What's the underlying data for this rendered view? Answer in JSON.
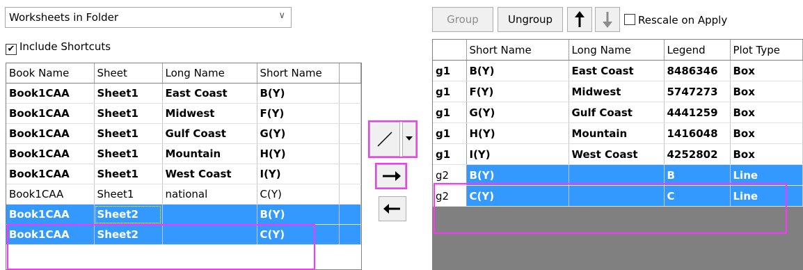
{
  "source_combo": {
    "value": "Worksheets in Folder"
  },
  "include_shortcuts": {
    "label": "Include Shortcuts",
    "checked": true
  },
  "left_table": {
    "headers": [
      "Book Name",
      "Sheet",
      "Long Name",
      "Short Name"
    ],
    "rows": [
      {
        "book": "Book1CAA",
        "sheet": "Sheet1",
        "long": "East Coast",
        "short": "B(Y)",
        "style": "bold"
      },
      {
        "book": "Book1CAA",
        "sheet": "Sheet1",
        "long": "Midwest",
        "short": "F(Y)",
        "style": "bold"
      },
      {
        "book": "Book1CAA",
        "sheet": "Sheet1",
        "long": "Gulf Coast",
        "short": "G(Y)",
        "style": "bold"
      },
      {
        "book": "Book1CAA",
        "sheet": "Sheet1",
        "long": "Mountain",
        "short": "H(Y)",
        "style": "bold"
      },
      {
        "book": "Book1CAA",
        "sheet": "Sheet1",
        "long": "West Coast",
        "short": "I(Y)",
        "style": "bold"
      },
      {
        "book": "Book1CAA",
        "sheet": "Sheet1",
        "long": "national",
        "short": "C(Y)",
        "style": "normal"
      },
      {
        "book": "Book1CAA",
        "sheet": "Sheet2",
        "long": "",
        "short": "B(Y)",
        "style": "selected"
      },
      {
        "book": "Book1CAA",
        "sheet": "Sheet2",
        "long": "",
        "short": "C(Y)",
        "style": "selected"
      }
    ]
  },
  "toolbar": {
    "group_label": "Group",
    "ungroup_label": "Ungroup",
    "move_up_icon": "arrow-up-icon",
    "move_down_icon": "arrow-down-icon",
    "rescale_label": "Rescale on Apply",
    "rescale_checked": false
  },
  "right_table": {
    "headers": [
      "",
      "Short Name",
      "Long Name",
      "Legend",
      "Plot Type"
    ],
    "rows": [
      {
        "group": "g1",
        "short": "B(Y)",
        "long": "East Coast",
        "legend": "8486346",
        "plot": "Box",
        "style": "bold"
      },
      {
        "group": "g1",
        "short": "F(Y)",
        "long": "Midwest",
        "legend": "5747273",
        "plot": "Box",
        "style": "bold"
      },
      {
        "group": "g1",
        "short": "G(Y)",
        "long": "Gulf Coast",
        "legend": "4441259",
        "plot": "Box",
        "style": "bold"
      },
      {
        "group": "g1",
        "short": "H(Y)",
        "long": "Mountain",
        "legend": "1416048",
        "plot": "Box",
        "style": "bold"
      },
      {
        "group": "g1",
        "short": "I(Y)",
        "long": "West Coast",
        "legend": "4252802",
        "plot": "Box",
        "style": "bold"
      },
      {
        "group": "g2",
        "short": "B(Y)",
        "long": "",
        "legend": "B",
        "plot": "Line",
        "style": "selected"
      },
      {
        "group": "g2",
        "short": "C(Y)",
        "long": "",
        "legend": "C",
        "plot": "Line",
        "style": "selected"
      }
    ]
  },
  "mid_buttons": {
    "plot_type_icon": "line-plot-icon",
    "add_icon": "arrow-right-icon",
    "remove_icon": "arrow-left-icon"
  },
  "colors": {
    "selection": "#3399ff",
    "highlight": "#ff33ff",
    "empty_grid": "#808080"
  }
}
